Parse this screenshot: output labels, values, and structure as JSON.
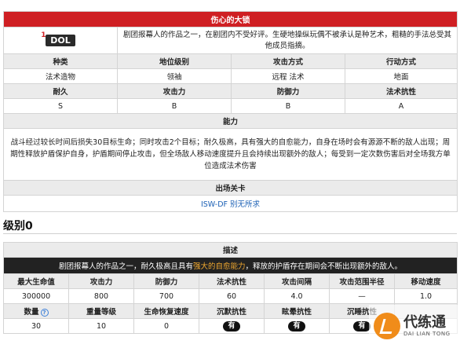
{
  "enemy": {
    "name": "伤心的大锁",
    "badge_mark": "1",
    "badge_text": "DOL",
    "description": "剧团报幕人的作品之一，在剧团内不受好评。生硬地操纵玩偶不被承认是种艺术，粗糙的手法总受其他成员指摘。",
    "stat_headers_1": [
      "种类",
      "地位级别",
      "攻击方式",
      "行动方式"
    ],
    "stat_values_1": [
      "法术造物",
      "领袖",
      "远程 法术",
      "地面"
    ],
    "stat_headers_2": [
      "耐久",
      "攻击力",
      "防御力",
      "法术抗性"
    ],
    "stat_values_2": [
      "S",
      "B",
      "B",
      "A"
    ],
    "ability_header": "能力",
    "ability_text": "战斗经过较长时间后损失30目标生命；同时攻击2个目标；耐久极高，具有强大的自愈能力，自身在场时会有源源不断的敌人出现；周期性释放护盾保护自身，护盾期间停止攻击，但全场敌人移动速度提升且会持续出现额外的敌人；每受到一定次数伤害后对全场我方单位造成法术伤害",
    "stages_header": "出场关卡",
    "stage_link": "ISW-DF 别无所求"
  },
  "level_section": {
    "heading": "级别0",
    "desc_header": "描述",
    "desc_before": "剧团报幕人的作品之一，耐久极高且具有",
    "desc_highlight": "强大的自愈能力",
    "desc_after": "，释放的护盾存在期间会不断出现额外的敌人。",
    "headers_1": [
      "最大生命值",
      "攻击力",
      "防御力",
      "法术抗性",
      "攻击间隔",
      "攻击范围半径",
      "移动速度"
    ],
    "values_1": [
      "300000",
      "800",
      "700",
      "60",
      "4.0",
      "—",
      "1.0"
    ],
    "headers_2": [
      "数量",
      "重量等级",
      "生命恢复速度",
      "沉默抗性",
      "眩晕抗性",
      "沉睡抗性",
      ""
    ],
    "values_2": [
      "30",
      "10",
      "0",
      "有",
      "有",
      "有",
      ""
    ]
  },
  "watermark": {
    "cn": "代练通",
    "en": "DAI LIAN TONG"
  },
  "colors": {
    "title_red": "#cf1f23",
    "header_gray": "#ebebeb",
    "highlight_orange": "#f0a830",
    "link_blue": "#1a5fb4"
  }
}
